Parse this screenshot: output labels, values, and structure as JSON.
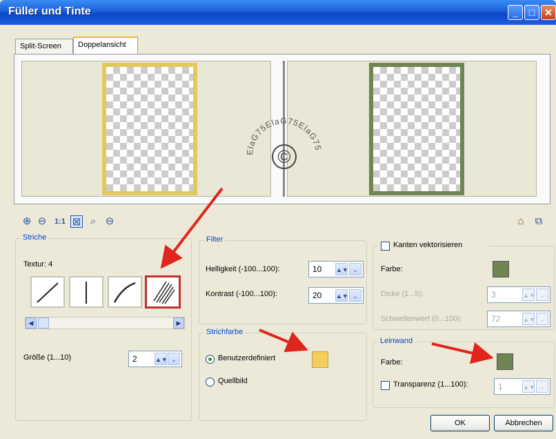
{
  "window": {
    "title": "Füller und Tinte"
  },
  "tabs": [
    {
      "label": "Split-Screen"
    },
    {
      "label": "Doppelansicht"
    }
  ],
  "watermark_text": "ElaG75ElaG75ElaG75",
  "watermark_symbol": "©",
  "toolbar": {
    "one_to_one": "1:1"
  },
  "striche": {
    "title": "Striche",
    "texture_label": "Textur: 4",
    "size_label": "Größe (1...10)",
    "size_value": "2"
  },
  "filter": {
    "title": "Filter",
    "brightness_label": "Helligkeit (-100...100):",
    "brightness_value": "10",
    "contrast_label": "Kontrast (-100...100):",
    "contrast_value": "20"
  },
  "strichfarbe": {
    "title": "Strichfarbe",
    "custom_label": "Benutzerdefiniert",
    "source_label": "Quellbild",
    "color": "#f4cd5b"
  },
  "kanten": {
    "title": "Kanten vektorisieren",
    "color_label": "Farbe:",
    "color": "#6f8552",
    "thickness_label": "Dicke (1...5):",
    "thickness_value": "3",
    "threshold_label": "Schwellenwert (0...100):",
    "threshold_value": "72"
  },
  "leinwand": {
    "title": "Leinwand",
    "color_label": "Farbe:",
    "color": "#6f8552",
    "transparency_label": "Transparenz (1...100):",
    "transparency_value": "1"
  },
  "buttons": {
    "ok": "OK",
    "cancel": "Abbrechen"
  },
  "colors": {
    "arrow": "#e0261c",
    "left_frame": "#e1c95c",
    "right_frame": "#6f8552"
  }
}
